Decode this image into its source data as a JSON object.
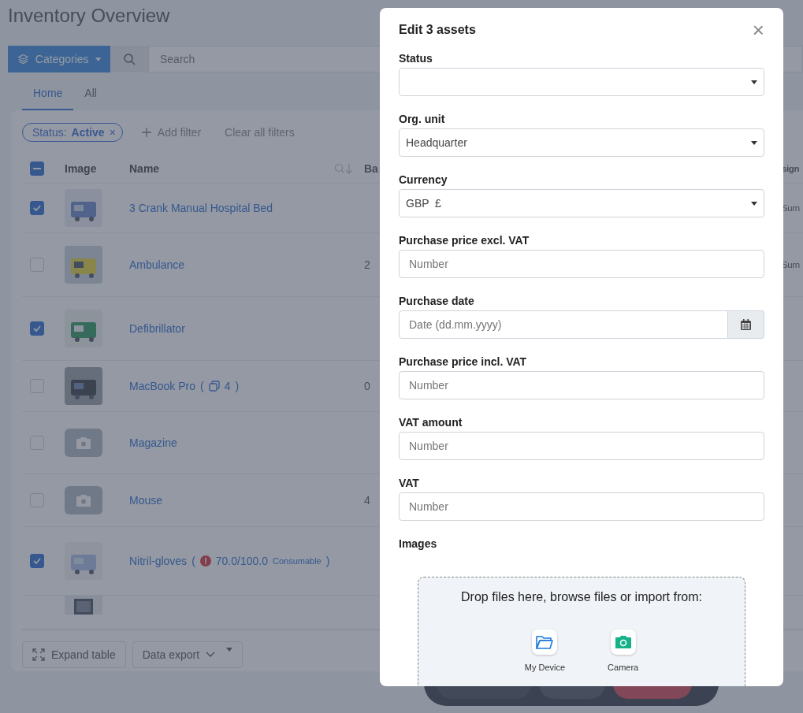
{
  "page": {
    "title": "Inventory Overview"
  },
  "toolbar": {
    "categories_button": "Categories",
    "search": {
      "placeholder": "Search"
    }
  },
  "tabs": [
    {
      "label": "Home",
      "selected": true
    },
    {
      "label": "All",
      "selected": false
    }
  ],
  "filters": {
    "chips": [
      {
        "label": "Status:",
        "value": "Active",
        "remove": "×"
      }
    ],
    "add_filter": "Add filter",
    "clear": "Clear all filters"
  },
  "table": {
    "select_all_indeterminate": true,
    "columns": [
      "Image",
      "Name",
      "Ba",
      "sign"
    ],
    "rows": [
      {
        "checked": true,
        "name": "3 Crank Manual Hospital Bed",
        "column_4": "Surn"
      },
      {
        "checked": false,
        "name": "Ambulance",
        "column_3": "2",
        "column_4": "Surn"
      },
      {
        "checked": true,
        "name": "Defibrillator"
      },
      {
        "checked": false,
        "name": "MacBook Pro",
        "extra": {
          "kind": "copies",
          "open": "(",
          "count": "4",
          "close": ")"
        },
        "column_3": "0"
      },
      {
        "checked": false,
        "kind": "no_image",
        "name": "Magazine"
      },
      {
        "checked": false,
        "kind": "no_image",
        "name": "Mouse",
        "column_3": "4"
      },
      {
        "checked": true,
        "name": "Nitril-gloves",
        "extra": {
          "kind": "stock",
          "open": "(",
          "amount": "70.0/100.0",
          "type": "Consumable",
          "close": ")"
        }
      }
    ]
  },
  "footer": {
    "expand": "Expand table",
    "export": "Data export"
  },
  "modal": {
    "title": "Edit 3 assets",
    "close": "×",
    "fields": [
      {
        "kind": "select",
        "label": "Status"
      },
      {
        "kind": "select",
        "label": "Org. unit",
        "value": "Headquarter"
      },
      {
        "kind": "select",
        "label": "Currency",
        "value": "GBP  £"
      },
      {
        "kind": "input",
        "label": "Purchase price excl. VAT",
        "placeholder": "Number"
      },
      {
        "kind": "date",
        "label": "Purchase date",
        "placeholder": "Date (dd.mm.yyyy)"
      },
      {
        "kind": "input",
        "label": "Purchase price incl. VAT",
        "placeholder": "Number"
      },
      {
        "kind": "input",
        "label": "VAT amount",
        "placeholder": "Number"
      },
      {
        "kind": "input",
        "label": "VAT",
        "placeholder": "Number"
      }
    ],
    "images_label": "Images",
    "dropzone": {
      "text": "Drop files here, browse files or import from:",
      "sources": [
        {
          "kind": "device",
          "label": "My Device"
        },
        {
          "kind": "camera",
          "label": "Camera"
        }
      ]
    }
  }
}
